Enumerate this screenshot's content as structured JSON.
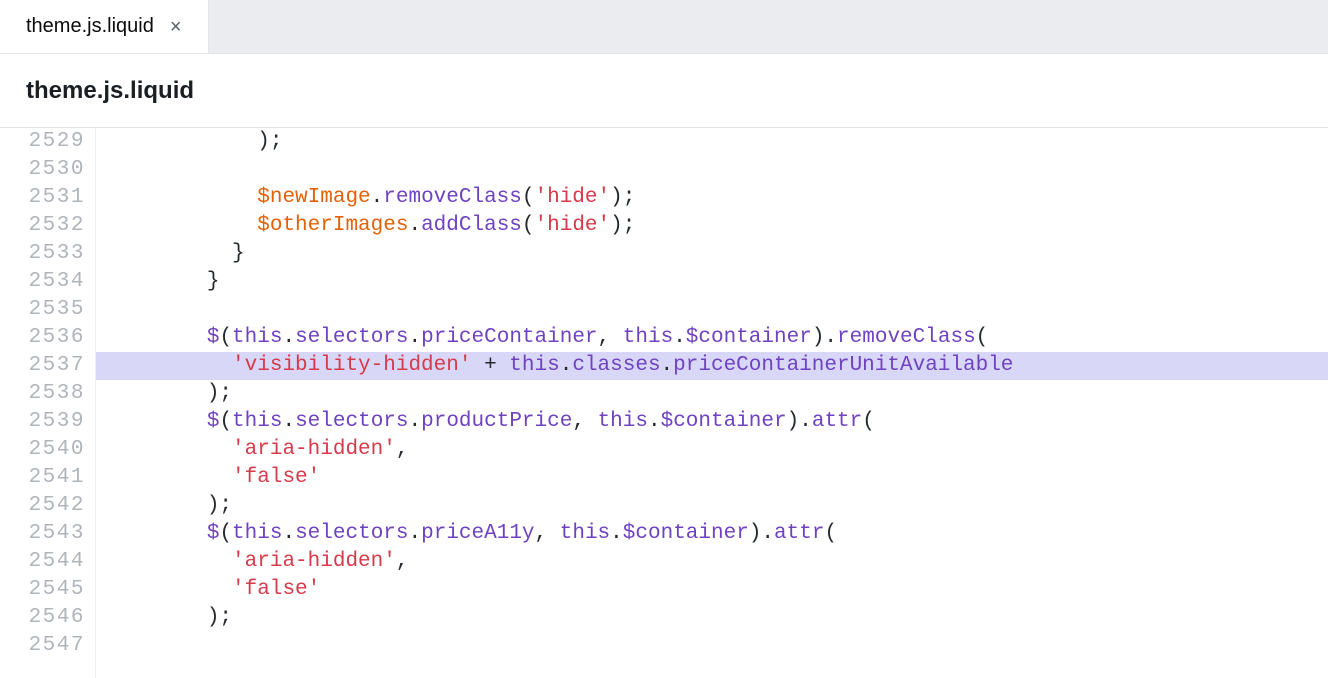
{
  "tab": {
    "label": "theme.js.liquid",
    "close_icon": "×"
  },
  "file_title": "theme.js.liquid",
  "gutter": {
    "start": 2529,
    "count": 19
  },
  "code": {
    "highlighted_line_index": 8,
    "lines": [
      [
        {
          "cls": "p",
          "txt": "            );"
        }
      ],
      [
        {
          "cls": "p",
          "txt": ""
        }
      ],
      [
        {
          "cls": "p",
          "txt": "            "
        },
        {
          "cls": "vr",
          "txt": "$newImage"
        },
        {
          "cls": "p",
          "txt": "."
        },
        {
          "cls": "kw",
          "txt": "removeClass"
        },
        {
          "cls": "p",
          "txt": "("
        },
        {
          "cls": "str",
          "txt": "'hide'"
        },
        {
          "cls": "p",
          "txt": ");"
        }
      ],
      [
        {
          "cls": "p",
          "txt": "            "
        },
        {
          "cls": "vr",
          "txt": "$otherImages"
        },
        {
          "cls": "p",
          "txt": "."
        },
        {
          "cls": "kw",
          "txt": "addClass"
        },
        {
          "cls": "p",
          "txt": "("
        },
        {
          "cls": "str",
          "txt": "'hide'"
        },
        {
          "cls": "p",
          "txt": ");"
        }
      ],
      [
        {
          "cls": "p",
          "txt": "          }"
        }
      ],
      [
        {
          "cls": "p",
          "txt": "        }"
        }
      ],
      [
        {
          "cls": "p",
          "txt": ""
        }
      ],
      [
        {
          "cls": "p",
          "txt": "        "
        },
        {
          "cls": "kw",
          "txt": "$"
        },
        {
          "cls": "p",
          "txt": "("
        },
        {
          "cls": "kw",
          "txt": "this"
        },
        {
          "cls": "p",
          "txt": "."
        },
        {
          "cls": "kw",
          "txt": "selectors"
        },
        {
          "cls": "p",
          "txt": "."
        },
        {
          "cls": "kw",
          "txt": "priceContainer"
        },
        {
          "cls": "p",
          "txt": ", "
        },
        {
          "cls": "kw",
          "txt": "this"
        },
        {
          "cls": "p",
          "txt": "."
        },
        {
          "cls": "kw",
          "txt": "$container"
        },
        {
          "cls": "p",
          "txt": ")."
        },
        {
          "cls": "kw",
          "txt": "removeClass"
        },
        {
          "cls": "p",
          "txt": "("
        }
      ],
      [
        {
          "cls": "p",
          "txt": "          "
        },
        {
          "cls": "str",
          "txt": "'visibility-hidden'"
        },
        {
          "cls": "p",
          "txt": " + "
        },
        {
          "cls": "kw",
          "txt": "this"
        },
        {
          "cls": "p",
          "txt": "."
        },
        {
          "cls": "kw",
          "txt": "classes"
        },
        {
          "cls": "p",
          "txt": "."
        },
        {
          "cls": "kw",
          "txt": "priceContainerUnitAvailable"
        }
      ],
      [
        {
          "cls": "p",
          "txt": "        );"
        }
      ],
      [
        {
          "cls": "p",
          "txt": "        "
        },
        {
          "cls": "kw",
          "txt": "$"
        },
        {
          "cls": "p",
          "txt": "("
        },
        {
          "cls": "kw",
          "txt": "this"
        },
        {
          "cls": "p",
          "txt": "."
        },
        {
          "cls": "kw",
          "txt": "selectors"
        },
        {
          "cls": "p",
          "txt": "."
        },
        {
          "cls": "kw",
          "txt": "productPrice"
        },
        {
          "cls": "p",
          "txt": ", "
        },
        {
          "cls": "kw",
          "txt": "this"
        },
        {
          "cls": "p",
          "txt": "."
        },
        {
          "cls": "kw",
          "txt": "$container"
        },
        {
          "cls": "p",
          "txt": ")."
        },
        {
          "cls": "kw",
          "txt": "attr"
        },
        {
          "cls": "p",
          "txt": "("
        }
      ],
      [
        {
          "cls": "p",
          "txt": "          "
        },
        {
          "cls": "str",
          "txt": "'aria-hidden'"
        },
        {
          "cls": "p",
          "txt": ","
        }
      ],
      [
        {
          "cls": "p",
          "txt": "          "
        },
        {
          "cls": "str",
          "txt": "'false'"
        }
      ],
      [
        {
          "cls": "p",
          "txt": "        );"
        }
      ],
      [
        {
          "cls": "p",
          "txt": "        "
        },
        {
          "cls": "kw",
          "txt": "$"
        },
        {
          "cls": "p",
          "txt": "("
        },
        {
          "cls": "kw",
          "txt": "this"
        },
        {
          "cls": "p",
          "txt": "."
        },
        {
          "cls": "kw",
          "txt": "selectors"
        },
        {
          "cls": "p",
          "txt": "."
        },
        {
          "cls": "kw",
          "txt": "priceA11y"
        },
        {
          "cls": "p",
          "txt": ", "
        },
        {
          "cls": "kw",
          "txt": "this"
        },
        {
          "cls": "p",
          "txt": "."
        },
        {
          "cls": "kw",
          "txt": "$container"
        },
        {
          "cls": "p",
          "txt": ")."
        },
        {
          "cls": "kw",
          "txt": "attr"
        },
        {
          "cls": "p",
          "txt": "("
        }
      ],
      [
        {
          "cls": "p",
          "txt": "          "
        },
        {
          "cls": "str",
          "txt": "'aria-hidden'"
        },
        {
          "cls": "p",
          "txt": ","
        }
      ],
      [
        {
          "cls": "p",
          "txt": "          "
        },
        {
          "cls": "str",
          "txt": "'false'"
        }
      ],
      [
        {
          "cls": "p",
          "txt": "        );"
        }
      ],
      [
        {
          "cls": "p",
          "txt": ""
        }
      ]
    ]
  }
}
